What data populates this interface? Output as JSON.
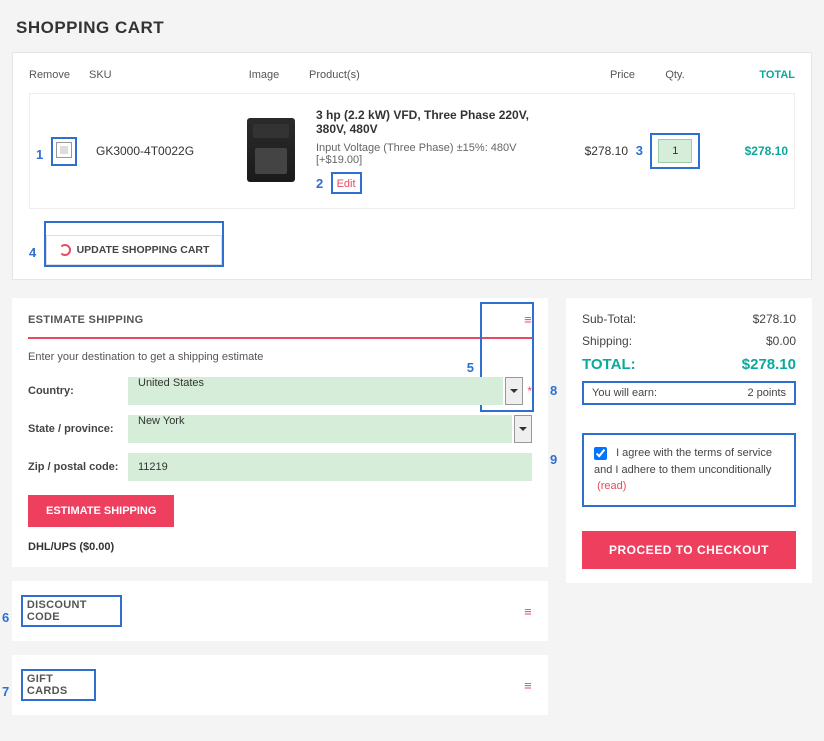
{
  "title": "SHOPPING CART",
  "headers": {
    "remove": "Remove",
    "sku": "SKU",
    "image": "Image",
    "product": "Product(s)",
    "price": "Price",
    "qty": "Qty.",
    "total": "TOTAL"
  },
  "item": {
    "sku": "GK3000-4T0022G",
    "name": "3 hp (2.2 kW) VFD, Three Phase 220V, 380V, 480V",
    "option": "Input Voltage (Three Phase) ±15%: 480V [+$19.00]",
    "edit": "Edit",
    "price": "$278.10",
    "qty": "1",
    "total": "$278.10"
  },
  "update_label": "UPDATE SHOPPING CART",
  "estimate": {
    "heading": "ESTIMATE SHIPPING",
    "hint": "Enter your destination to get a shipping estimate",
    "country_label": "Country:",
    "country_value": "United States",
    "state_label": "State / province:",
    "state_value": "New York",
    "zip_label": "Zip / postal code:",
    "zip_value": "11219",
    "button": "ESTIMATE SHIPPING",
    "method": "DHL/UPS ($0.00)"
  },
  "discount": {
    "heading": "DISCOUNT CODE"
  },
  "giftcards": {
    "heading": "GIFT CARDS"
  },
  "totals": {
    "subtotal_label": "Sub-Total:",
    "subtotal_value": "$278.10",
    "shipping_label": "Shipping:",
    "shipping_value": "$0.00",
    "total_label": "TOTAL:",
    "total_value": "$278.10",
    "earn_label": "You will earn:",
    "earn_value": "2 points"
  },
  "agree": {
    "text_a": "I agree with the terms of service and I adhere to them unconditionally",
    "read": "(read)"
  },
  "checkout": "PROCEED TO CHECKOUT",
  "markers": {
    "m1": "1",
    "m2": "2",
    "m3": "3",
    "m4": "4",
    "m5": "5",
    "m6": "6",
    "m7": "7",
    "m8": "8",
    "m9": "9"
  }
}
